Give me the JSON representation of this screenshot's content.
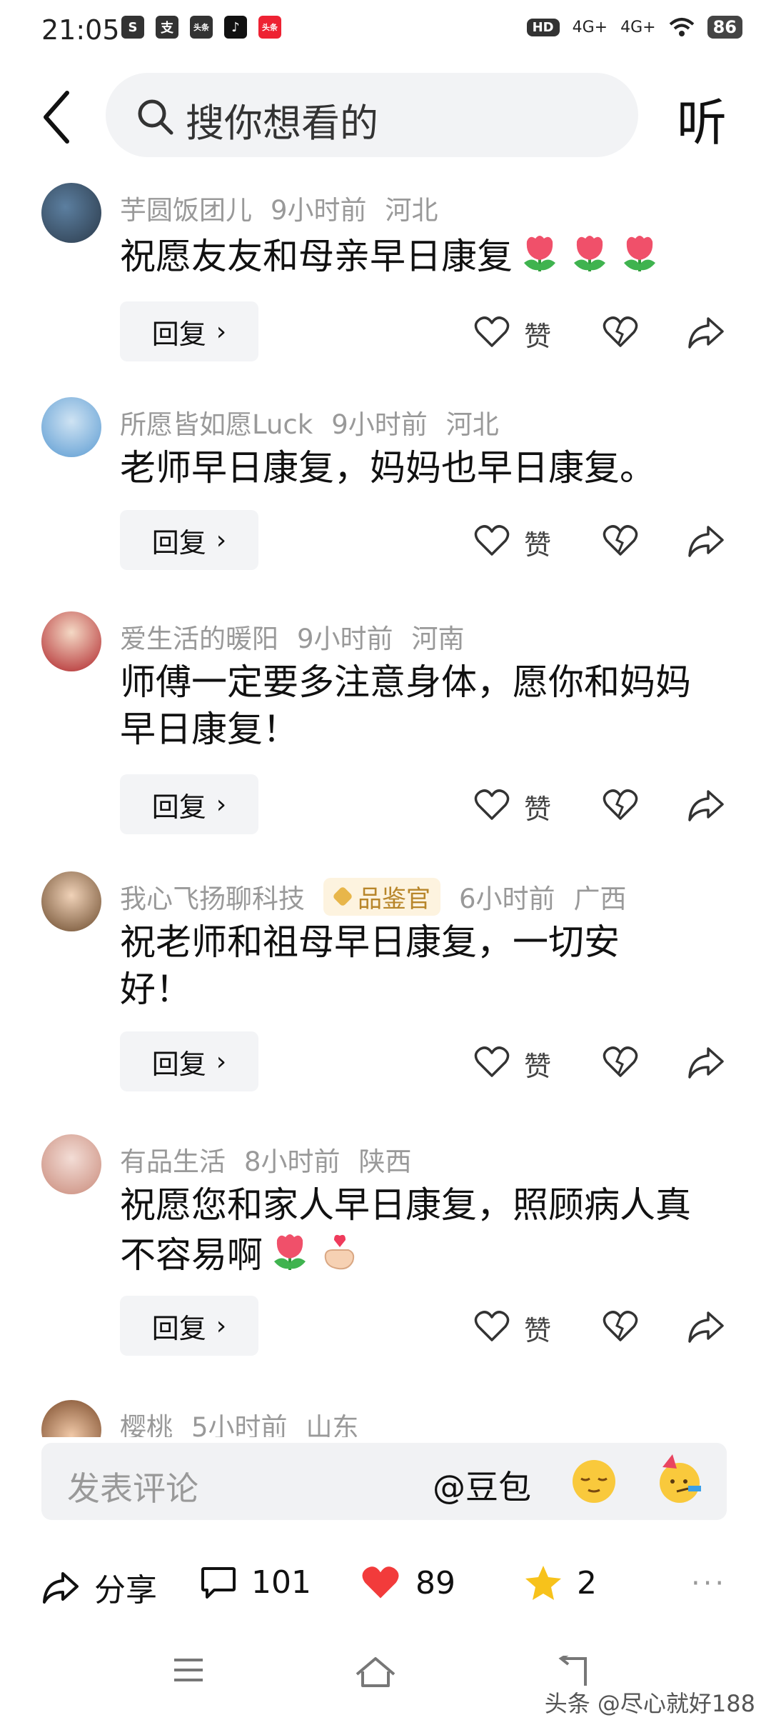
{
  "status_bar": {
    "time": "21:05",
    "apps": [
      "S",
      "支",
      "头条",
      "♪",
      "头条"
    ],
    "network": "4G+",
    "network2": "4G+",
    "hd": "HD",
    "battery": "86"
  },
  "header": {
    "search_placeholder": "搜你想看的",
    "listen_label": "听"
  },
  "comments": [
    {
      "user": "芋圆饭团儿",
      "time": "9小时前",
      "location": "河北",
      "badge": "",
      "text": "祝愿友友和母亲早日康复",
      "emoji": [
        "tulip",
        "tulip",
        "tulip"
      ],
      "reply": "回复",
      "like": "赞"
    },
    {
      "user": "所愿皆如愿Luck",
      "time": "9小时前",
      "location": "河北",
      "badge": "",
      "text": "老师早日康复，妈妈也早日康复。",
      "emoji": [],
      "reply": "回复",
      "like": "赞"
    },
    {
      "user": "爱生活的暖阳",
      "time": "9小时前",
      "location": "河南",
      "badge": "",
      "text": "师傅一定要多注意身体，愿你和妈妈早日康复！",
      "emoji": [],
      "reply": "回复",
      "like": "赞"
    },
    {
      "user": "我心飞扬聊科技",
      "time": "6小时前",
      "location": "广西",
      "badge": "品鉴官",
      "text": "祝老师和祖母早日康复，一切安好！",
      "emoji": [],
      "reply": "回复",
      "like": "赞"
    },
    {
      "user": "有品生活",
      "time": "8小时前",
      "location": "陕西",
      "badge": "",
      "text": "祝愿您和家人早日康复，照顾病人真不容易啊",
      "emoji": [
        "tulip",
        "finger-heart"
      ],
      "reply": "回复",
      "like": "赞"
    },
    {
      "user": "樱桃",
      "time": "5小时前",
      "location": "山东",
      "badge": "",
      "text": "",
      "emoji": [],
      "reply": "",
      "like": ""
    }
  ],
  "input_bar": {
    "placeholder": "发表评论",
    "mention": "@豆包",
    "emoji_1": "relieved-face",
    "emoji_2": "party-face"
  },
  "bottom_bar": {
    "share_label": "分享",
    "comment_count": "101",
    "like_count": "89",
    "favorite_count": "2",
    "more": "···"
  },
  "watermark": "头条 @尽心就好188",
  "colors": {
    "like_red": "#f23b3b",
    "star_yellow": "#f7c21b",
    "badge_gold": "#b8862a"
  }
}
